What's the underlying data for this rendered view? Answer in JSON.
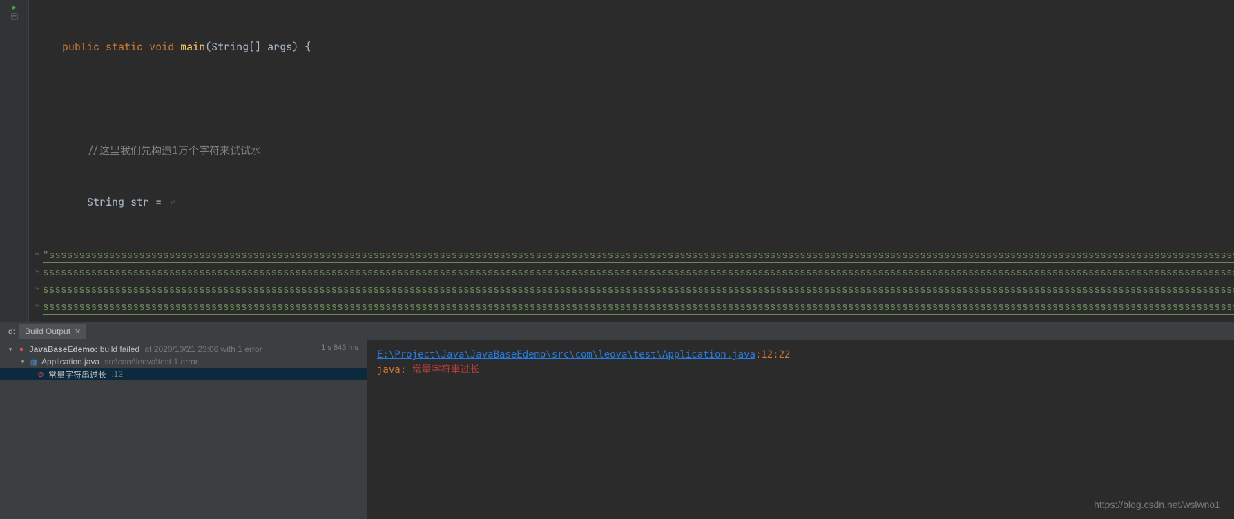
{
  "editor": {
    "method_signature": {
      "kw_public": "public",
      "kw_static": "static",
      "kw_void": "void",
      "method_name": "main",
      "params_open": "(",
      "param_type": "String[]",
      "param_name": "args",
      "params_close": ")",
      "brace": "{"
    },
    "comment_line": "//这里我们先构造1万个字符来试试水",
    "string_decl": {
      "type": "String",
      "var": "str",
      "eq": "="
    },
    "string_literal_row_prefix": "\"",
    "string_literal_char": "s",
    "wrap_symbol": "↪"
  },
  "panel": {
    "side_label": "d:",
    "tab_label": "Build Output",
    "build_timing": "1 s 843 ms",
    "tree": {
      "root_name": "JavaBaseEdemo:",
      "root_status": "build failed",
      "root_meta": "at 2020/10/21 23:06 with 1 error",
      "file_name": "Application.java",
      "file_meta": "src\\com\\leova\\test 1 error",
      "error_text": "常量字符串过长",
      "error_line": ":12"
    },
    "message": {
      "file_path": "E:\\Project\\Java\\JavaBaseEdemo\\src\\com\\leova\\test\\Application.java",
      "line_col": ":12:22",
      "compiler": "java:",
      "error_text": "常量字符串过长"
    }
  },
  "watermark": "https://blog.csdn.net/wslwno1"
}
